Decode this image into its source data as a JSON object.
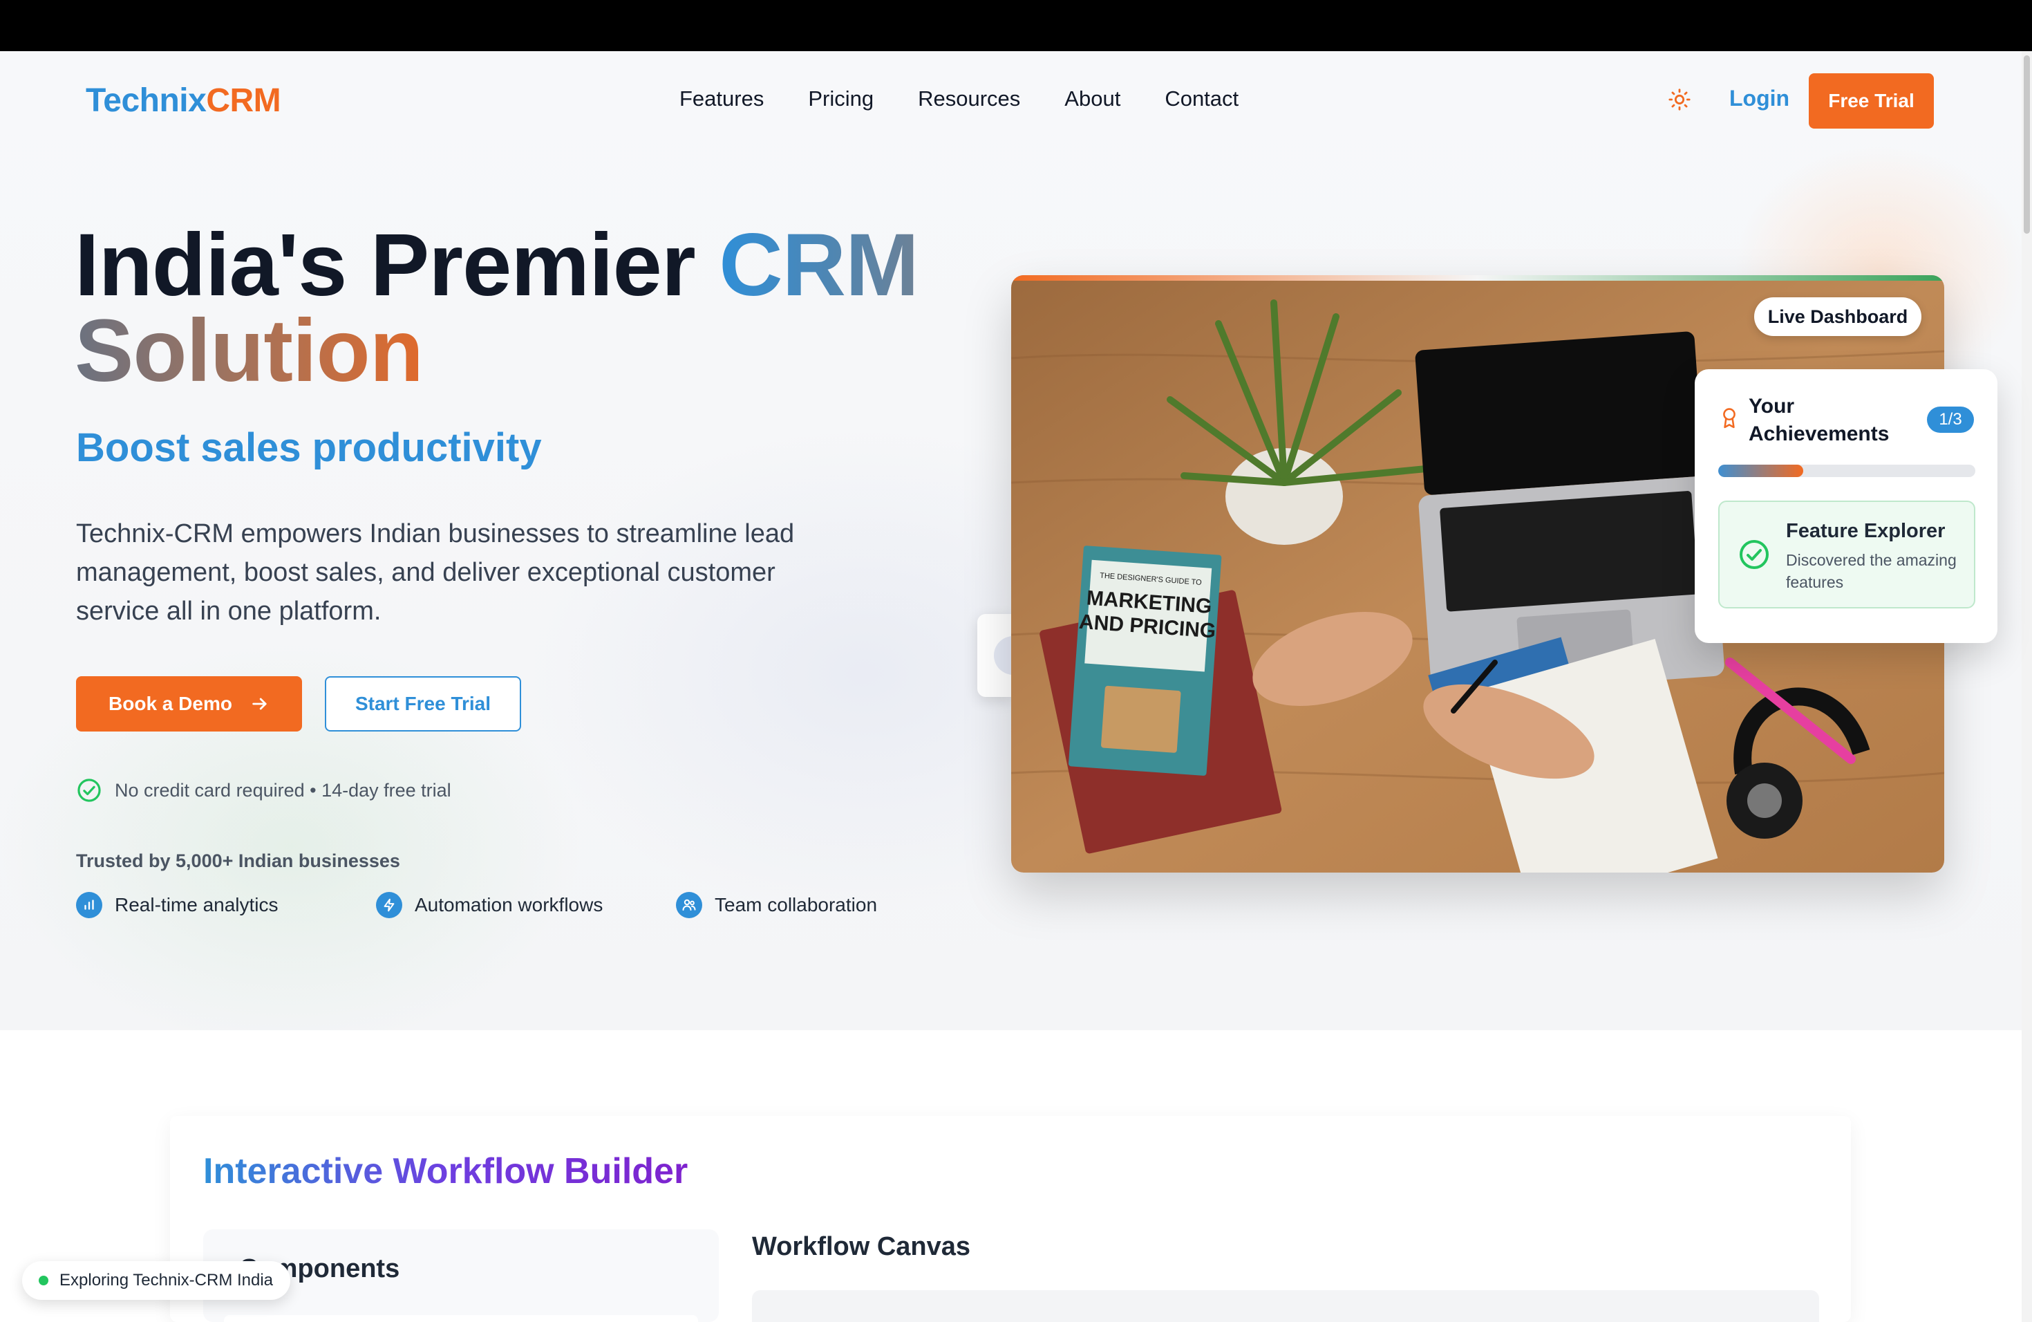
{
  "brand": {
    "part1": "Technix",
    "part2": "CRM"
  },
  "nav": {
    "items": [
      "Features",
      "Pricing",
      "Resources",
      "About",
      "Contact"
    ],
    "login": "Login",
    "free_trial": "Free Trial"
  },
  "hero": {
    "title_line1_a": "India's Premier ",
    "title_line1_b": "CRM",
    "title_line2": "Solution",
    "subhead": "Boost sales productivity",
    "description": "Technix-CRM empowers Indian businesses to streamline lead management, boost sales, and deliver exceptional customer service all in one platform.",
    "book_demo": "Book a Demo",
    "start_trial": "Start Free Trial",
    "no_cc": "No credit card required • 14-day free trial",
    "trusted": "Trusted by 5,000+ Indian businesses",
    "features": [
      "Real-time analytics",
      "Automation workflows",
      "Team collaboration"
    ]
  },
  "dashboard": {
    "live_badge": "Live Dashboard",
    "book_cover": {
      "line1": "THE DESIGNER'S GUIDE TO",
      "line2": "MARKETING",
      "line3": "AND PRICING"
    },
    "achievements": {
      "title": "Your Achievements",
      "count": "1/3",
      "progress": 0.33,
      "item_title": "Feature Explorer",
      "item_desc": "Discovered the amazing features"
    }
  },
  "workflow": {
    "title": "Interactive Workflow Builder",
    "components": "Components",
    "canvas": "Workflow Canvas"
  },
  "toast": "Exploring Technix-CRM India",
  "colors": {
    "blue": "#2f8fd8",
    "orange": "#f26a21",
    "green": "#22c55e"
  }
}
